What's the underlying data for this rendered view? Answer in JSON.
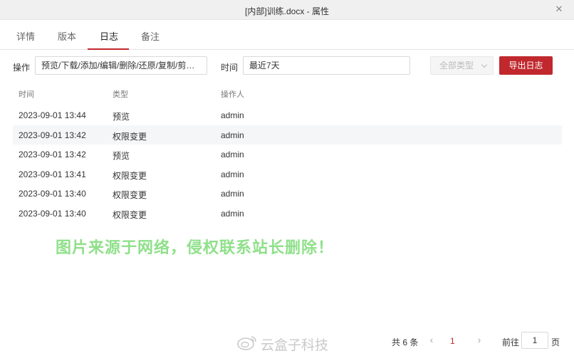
{
  "window": {
    "title": "[内部]训练.docx - 属性"
  },
  "tabs": [
    {
      "label": "详情"
    },
    {
      "label": "版本"
    },
    {
      "label": "日志"
    },
    {
      "label": "备注"
    }
  ],
  "active_tab": "日志",
  "filters": {
    "operation_label": "操作",
    "operation_value": "预览/下载/添加/编辑/删除/还原/复制/剪切/...",
    "time_label": "时间",
    "time_value": "最近7天",
    "type_select": "全部类型",
    "export_label": "导出日志"
  },
  "table": {
    "columns": [
      "时间",
      "类型",
      "操作人"
    ],
    "rows": [
      {
        "time": "2023-09-01 13:44",
        "type": "预览",
        "user": "admin"
      },
      {
        "time": "2023-09-01 13:42",
        "type": "权限变更",
        "user": "admin"
      },
      {
        "time": "2023-09-01 13:42",
        "type": "预览",
        "user": "admin"
      },
      {
        "time": "2023-09-01 13:41",
        "type": "权限变更",
        "user": "admin"
      },
      {
        "time": "2023-09-01 13:40",
        "type": "权限变更",
        "user": "admin"
      },
      {
        "time": "2023-09-01 13:40",
        "type": "权限变更",
        "user": "admin"
      }
    ]
  },
  "overlay_text": "图片来源于网络，侵权联系站长删除！",
  "footer_watermark": "云盒子科技",
  "pagination": {
    "total": "共 6 条",
    "current_page": "1",
    "goto_label": "前往",
    "goto_value": "1",
    "page_suffix": "页"
  },
  "colors": {
    "accent": "#c0282d",
    "overlay_text": "#8fe08a",
    "row_alt": "#f5f6f8"
  }
}
